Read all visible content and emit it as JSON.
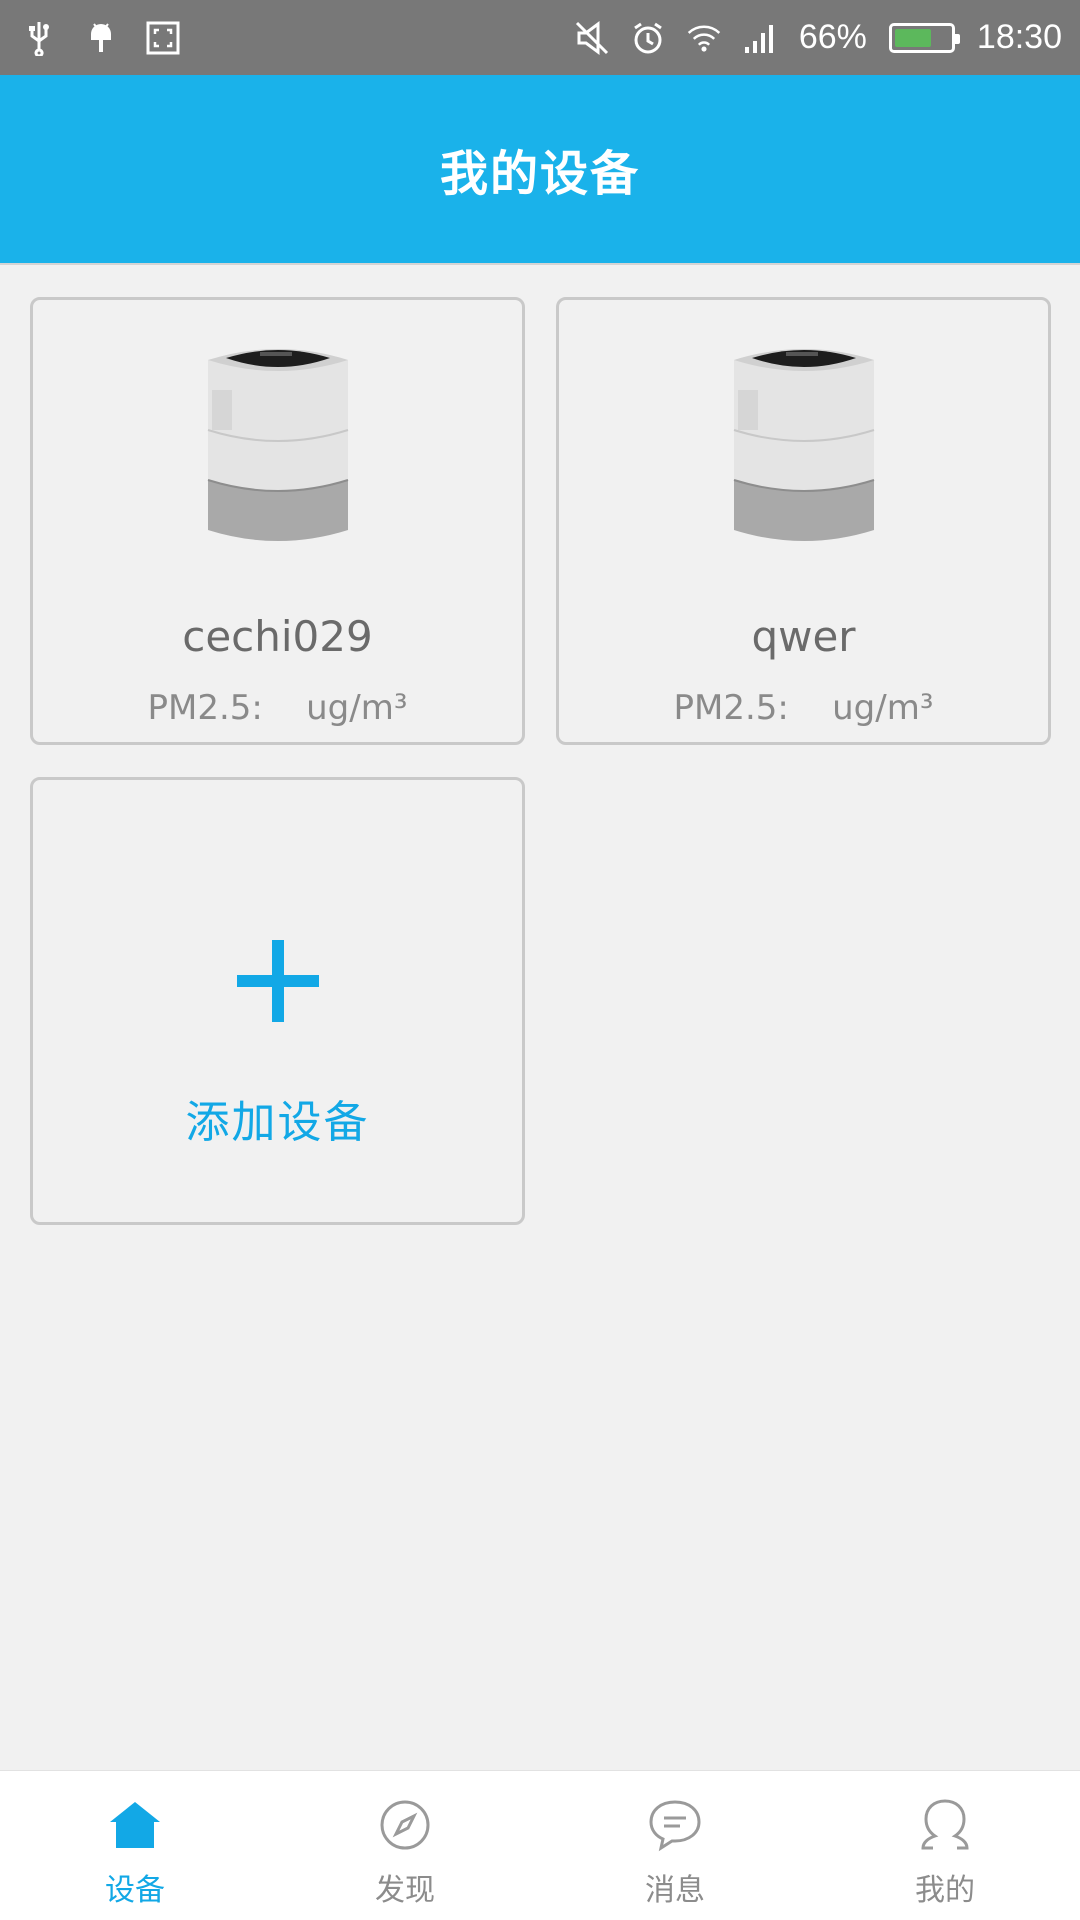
{
  "status_bar": {
    "icons_left": [
      "usb-icon",
      "android-debug-icon",
      "screenshot-icon"
    ],
    "icons_right": [
      "mute-icon",
      "alarm-icon",
      "wifi-icon",
      "signal-icon"
    ],
    "battery_percent": "66%",
    "battery_level": 0.66,
    "time": "18:30"
  },
  "header": {
    "title": "我的设备"
  },
  "devices": [
    {
      "name": "cechi029",
      "pm_label": "PM2.5:",
      "pm_value": "",
      "pm_unit": "ug/m³"
    },
    {
      "name": "qwer",
      "pm_label": "PM2.5:",
      "pm_value": "",
      "pm_unit": "ug/m³"
    }
  ],
  "add_device": {
    "label": "添加设备",
    "icon": "plus-icon"
  },
  "bottom_nav": {
    "items": [
      {
        "label": "设备",
        "icon": "home-icon",
        "active": true
      },
      {
        "label": "发现",
        "icon": "compass-icon",
        "active": false
      },
      {
        "label": "消息",
        "icon": "chat-icon",
        "active": false
      },
      {
        "label": "我的",
        "icon": "profile-icon",
        "active": false
      }
    ]
  },
  "colors": {
    "accent": "#1ab2ea",
    "accent_text": "#12a8e6",
    "status_bar": "#787878",
    "background": "#f1f1f1",
    "battery": "#5cb85c"
  }
}
